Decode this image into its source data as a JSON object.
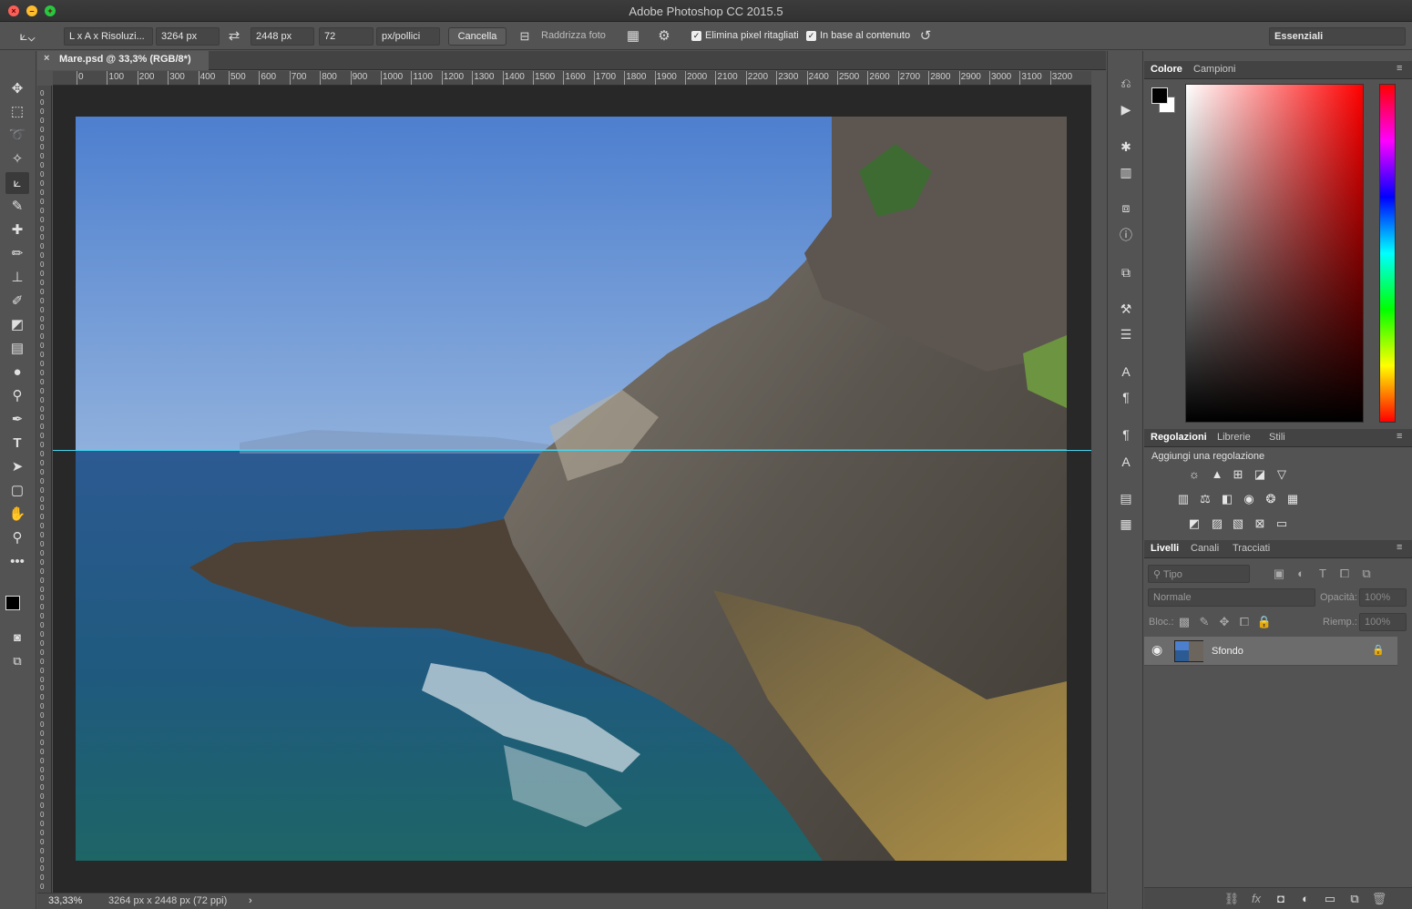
{
  "app": {
    "title": "Adobe Photoshop CC 2015.5"
  },
  "options": {
    "preset": "L x A x Risoluzi...",
    "width": "3264 px",
    "height": "2448 px",
    "resolution": "72",
    "unit": "px/pollici",
    "cancel": "Cancella",
    "straighten": "Raddrizza foto",
    "delete_cropped": "Elimina pixel ritagliati",
    "content_aware": "In base al contenuto",
    "workspace": "Essenziali"
  },
  "document": {
    "tab": "Mare.psd @ 33,3% (RGB/8*)",
    "ruler_h": [
      "0",
      "100",
      "200",
      "300",
      "400",
      "500",
      "600",
      "700",
      "800",
      "900",
      "1000",
      "1100",
      "1200",
      "1300",
      "1400",
      "1500",
      "1600",
      "1700",
      "1800",
      "1900",
      "2000",
      "2100",
      "2200",
      "2300",
      "2400",
      "2500",
      "2600",
      "2700",
      "2800",
      "2900",
      "3000",
      "3100",
      "3200"
    ],
    "ruler_v": [
      "0",
      "0",
      "0",
      "0",
      "0",
      "0",
      "0",
      "0",
      "0",
      "0",
      "0",
      "0",
      "0",
      "0",
      "0",
      "0",
      "0",
      "0",
      "0",
      "0",
      "0",
      "0",
      "0",
      "0",
      "0",
      "0",
      "0",
      "0",
      "0",
      "0",
      "0",
      "0",
      "0",
      "0",
      "0",
      "0",
      "0",
      "0",
      "0",
      "0",
      "0",
      "0",
      "0",
      "0",
      "0",
      "0",
      "0",
      "0",
      "0",
      "0",
      "0",
      "0",
      "0",
      "0",
      "0",
      "0",
      "0",
      "0",
      "0",
      "0",
      "0",
      "0",
      "0",
      "0",
      "0",
      "0",
      "0",
      "0",
      "0",
      "0",
      "0",
      "0",
      "0",
      "0",
      "0",
      "0",
      "0",
      "0",
      "0",
      "0",
      "0",
      "0",
      "0",
      "0",
      "0",
      "0",
      "0",
      "0",
      "0",
      "0"
    ]
  },
  "status": {
    "zoom": "33,33%",
    "info": "3264 px x 2448 px (72 ppi)"
  },
  "panels": {
    "color": {
      "tabs": [
        "Colore",
        "Campioni"
      ]
    },
    "adjustments": {
      "tabs": [
        "Regolazioni",
        "Librerie",
        "Stili"
      ],
      "title": "Aggiungi una regolazione"
    },
    "layers": {
      "tabs": [
        "Livelli",
        "Canali",
        "Tracciati"
      ],
      "filter": "Tipo",
      "blend": "Normale",
      "opacity_label": "Opacità:",
      "opacity": "100%",
      "lock_label": "Bloc.:",
      "fill_label": "Riemp.:",
      "fill": "100%",
      "layer_name": "Sfondo"
    }
  },
  "colors": {
    "accent": "#31a7c4",
    "guide": "#44d6f0"
  }
}
